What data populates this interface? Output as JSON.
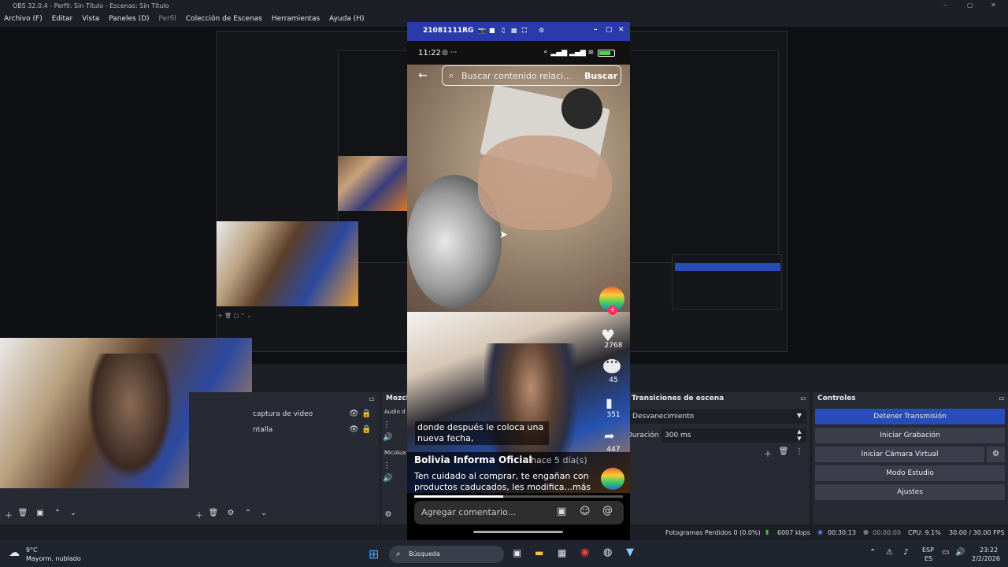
{
  "titlebar": {
    "title": "OBS 32.0.4 - Perfil: Sin Título - Escenas: Sin Título",
    "min": "–",
    "max": "▢",
    "close": "✕"
  },
  "menu": [
    {
      "label": "Archivo (F)"
    },
    {
      "label": "Editar"
    },
    {
      "label": "Vista"
    },
    {
      "label": "Paneles (D)"
    },
    {
      "label": "Perfil"
    },
    {
      "label": "Colección de Escenas"
    },
    {
      "label": "Herramientas"
    },
    {
      "label": "Ayuda (H)"
    }
  ],
  "sources": {
    "items": [
      "captura de video",
      "ntalla"
    ]
  },
  "mixer": {
    "title": "Mezcla",
    "channels": [
      "Audio d",
      "Mic/Aux"
    ]
  },
  "transitions": {
    "title": "Transiciones de escena",
    "selected": "Desvanecimiento",
    "duration_label": "Duración",
    "duration_value": "300 ms"
  },
  "controls": {
    "title": "Controles",
    "stop_stream": "Detener Transmisión",
    "start_record": "Iniciar Grabación",
    "virtual_cam": "Iniciar Cámara Virtual",
    "studio_mode": "Modo Estudio",
    "settings": "Ajustes"
  },
  "status": {
    "dropped": "Fotogramas Perdidos 0 (0.0%)",
    "bitrate": "6007 kbps",
    "stream_time": "00:30:13",
    "rec_time": "00:00:00",
    "cpu": "CPU: 9.1%",
    "fps": "30.00 / 30.00 FPS"
  },
  "phone": {
    "window_title": "21081111RG",
    "time": "11:22",
    "battery": "",
    "search_placeholder": "Buscar contenido relaci...",
    "search_button": "Buscar",
    "likes": "2768",
    "comments": "45",
    "saves": "351",
    "shares": "447",
    "caption_overlay": "donde después le coloca una nueva fecha,",
    "author": "Bolivia Informa Oficial",
    "posted": "· hace 5 día(s)",
    "description": "Ten cuidado al comprar, te engañan con productos caducados, les modifica...más",
    "comment_placeholder": "Agregar comentario..."
  },
  "taskbar": {
    "weather_temp": "9°C",
    "weather_desc": "Mayorm. nublado",
    "search_label": "Búsqueda",
    "lang1": "ESP",
    "lang2": "ES",
    "clock_time": "23:22",
    "clock_date": "2/2/2026"
  },
  "colors": {
    "accent": "#284cb8",
    "dock": "#272a33",
    "phone_title": "#2b3aa9"
  }
}
